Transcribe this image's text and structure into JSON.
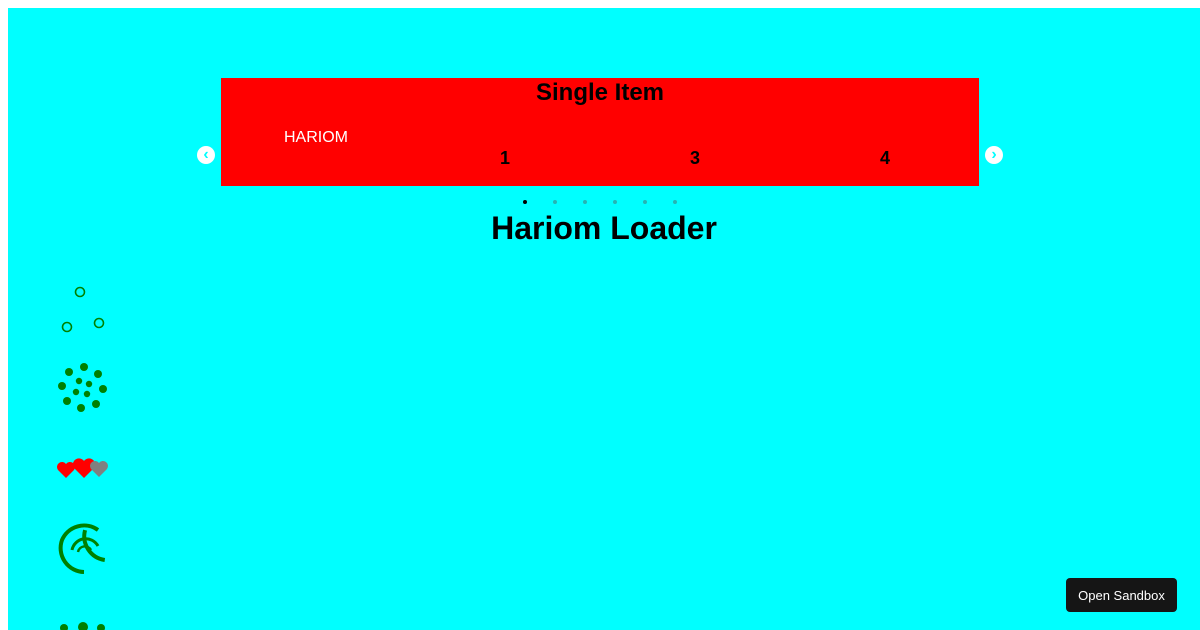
{
  "colors": {
    "page_background": "#00ffff",
    "slider_background": "#ff0000",
    "slide_text": "#ffffff",
    "active_dot": "#000000",
    "inactive_dot": "#27b4b4",
    "loader_green": "#008000",
    "heart_red": "#ff0000",
    "heart_gray": "#808080"
  },
  "slider": {
    "title": "Single Item",
    "slide_text": "HARIOM",
    "visible_numbers": [
      "1",
      "3",
      "4"
    ],
    "prev_icon": "chevron-left-circle-icon",
    "next_icon": "chevron-right-circle-icon",
    "dot_count": 6,
    "active_dot": 0
  },
  "loader_section": {
    "title": "Hariom Loader",
    "loaders": [
      "circles-loader-icon",
      "dots-spinner-loader-icon",
      "hearts-loader-icon",
      "arcs-loader-icon",
      "dots-row-loader-icon"
    ]
  },
  "sandbox_button": {
    "label": "Open Sandbox"
  }
}
